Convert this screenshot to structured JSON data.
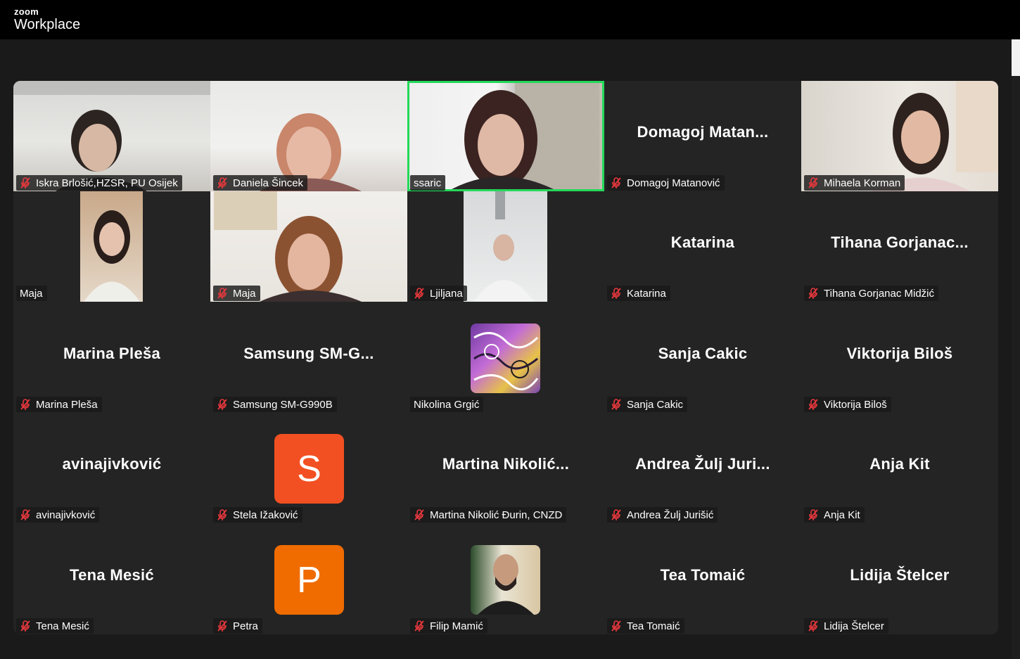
{
  "app": {
    "brand_small": "zoom",
    "brand_big": "Workplace"
  },
  "colors": {
    "active_speaker": "#23d959",
    "mute_icon": "#e8383d",
    "avatar_s": "#f25022",
    "avatar_p": "#f06c00"
  },
  "participants": [
    {
      "label": "Iskra Brlošić,HZSR, PU Osijek",
      "muted": true
    },
    {
      "label": "Daniela Šincek",
      "muted": true
    },
    {
      "label": "ssaric",
      "muted": false,
      "active_speaker": true
    },
    {
      "display": "Domagoj  Matan...",
      "label": "Domagoj Matanović",
      "muted": true
    },
    {
      "label": "Mihaela Korman",
      "muted": true
    },
    {
      "label": "Maja",
      "muted": false
    },
    {
      "label": "Maja",
      "muted": true
    },
    {
      "label": "Ljiljana",
      "muted": true
    },
    {
      "display": "Katarina",
      "label": "Katarina",
      "muted": true
    },
    {
      "display": "Tihana  Gorjanac...",
      "label": "Tihana Gorjanac Midžić",
      "muted": true
    },
    {
      "display": "Marina Pleša",
      "label": "Marina Pleša",
      "muted": true
    },
    {
      "display": "Samsung  SM-G...",
      "label": "Samsung SM-G990B",
      "muted": true
    },
    {
      "label": "Nikolina Grgić",
      "muted": false
    },
    {
      "display": "Sanja Cakic",
      "label": "Sanja Cakic",
      "muted": true
    },
    {
      "display": "Viktorija Biloš",
      "label": "Viktorija Biloš",
      "muted": true
    },
    {
      "display": "avinajivković",
      "label": "avinajivković",
      "muted": true
    },
    {
      "avatar": "S",
      "label": "Stela Ižaković",
      "muted": true
    },
    {
      "display": "Martina  Nikolić...",
      "label": "Martina Nikolić Đurin, CNZD",
      "muted": true
    },
    {
      "display": "Andrea  Žulj  Juri...",
      "label": "Andrea Žulj Jurišić",
      "muted": true
    },
    {
      "display": "Anja Kit",
      "label": "Anja Kit",
      "muted": true
    },
    {
      "display": "Tena Mesić",
      "label": "Tena Mesić",
      "muted": true
    },
    {
      "avatar": "P",
      "label": "Petra",
      "muted": true
    },
    {
      "label": "Filip Mamić",
      "muted": true
    },
    {
      "display": "Tea Tomaić",
      "label": "Tea Tomaić",
      "muted": true
    },
    {
      "display": "Lidija Štelcer",
      "label": "Lidija Štelcer",
      "muted": true
    }
  ]
}
